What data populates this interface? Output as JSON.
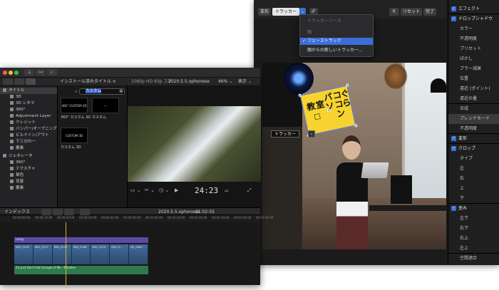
{
  "right_window": {
    "toolbar": {
      "transform_label": "変形",
      "tracker_label": "トラッカー",
      "chevron_glyph": "⌄",
      "link_glyph": "🔗",
      "fit_glyph": "⇱",
      "reset_label": "リセット",
      "done_label": "完了"
    },
    "dropdown": {
      "items": [
        {
          "label": "トラッカーソース"
        },
        {
          "label": "顔"
        },
        {
          "label": "フェーストラック",
          "checked": "✓"
        },
        {
          "label": "顔からの新しいトラッカー..."
        }
      ]
    },
    "video": {
      "sign_text": [
        "コ",
        "ぐ",
        "ら",
        "パ",
        "ソ",
        "コ",
        "ン",
        "教",
        "室",
        "□"
      ],
      "tracker_chip": "トラッカー",
      "tracker_chip_arrow": "⌄"
    },
    "inspector": {
      "items": [
        {
          "label": "エフェクト",
          "checked": true
        },
        {
          "label": "ドロップシャドウ",
          "checked": true
        },
        {
          "label": "カラー"
        },
        {
          "label": "不透明度"
        },
        {
          "label": "プリセット"
        },
        {
          "label": "ぼかし"
        },
        {
          "label": "ブラー減衰"
        },
        {
          "label": "位置"
        },
        {
          "label": "遠近 (ポイント)"
        },
        {
          "label": "遠近の量"
        },
        {
          "label": "合成"
        },
        {
          "label": "ブレンドモード"
        },
        {
          "label": "不透明度"
        },
        {
          "label": "変形",
          "checked": true
        },
        {
          "label": "クロップ",
          "checked": true
        },
        {
          "label": "タイプ"
        },
        {
          "label": "左"
        },
        {
          "label": "右"
        },
        {
          "label": "上"
        },
        {
          "label": "下"
        },
        {
          "label": "歪み",
          "checked": true
        },
        {
          "label": "左下"
        },
        {
          "label": "右下"
        },
        {
          "label": "右上"
        },
        {
          "label": "左上"
        },
        {
          "label": "空間適合"
        }
      ]
    }
  },
  "left_window": {
    "toolbar": {
      "icons": [
        "↓",
        "⊶",
        "✓"
      ]
    },
    "secbar": {
      "library_label": "インストール済みタイトル ≎",
      "format_label": "1080p HD 60p ステ",
      "project_label": "2020.5.5.ophonese",
      "zoom_label": "46% ⌄",
      "display_label": "表示 ⌄"
    },
    "sidebar": {
      "items": [
        {
          "label": "タイトル",
          "selected": true
        },
        {
          "label": "3D"
        },
        {
          "label": "3D シネマ"
        },
        {
          "label": "360°"
        },
        {
          "label": "Adjustment Layer"
        },
        {
          "label": "クレジット"
        },
        {
          "label": "バンパー/オープニング"
        },
        {
          "label": "ビルドイン/アウト"
        },
        {
          "label": "下三分の一"
        },
        {
          "label": "要素"
        },
        {
          "label": "ジェネレータ"
        },
        {
          "label": "360°"
        },
        {
          "label": "テクスチャ"
        },
        {
          "label": "単色"
        },
        {
          "label": "背景"
        },
        {
          "label": "要素"
        }
      ]
    },
    "browser": {
      "search_value": "カスタム",
      "clear_glyph": "⊗",
      "thumbs": [
        {
          "thumb_text": "360° CUSTOM 3D",
          "caption": "360° カスタム 3D"
        },
        {
          "thumb_text": "—",
          "caption": "カスタム"
        },
        {
          "thumb_text": "CUSTOM 3D",
          "caption": "カスタム 3D"
        }
      ]
    },
    "viewer": {
      "timecode": "24:23",
      "controls": [
        "▭ ⌄",
        "✂ ⌄",
        "◷ ⌄",
        "▶",
        "⌓",
        "⤢"
      ]
    },
    "timeline_bar": {
      "index_label": "インデックス",
      "project_label": "2020.5.5.ophonese",
      "duration_label": "01:02:55"
    },
    "ruler": {
      "ticks": [
        "00:00:00:00",
        "00:00:10:00",
        "00:00:20:00",
        "00:00:30:00",
        "00:00:40:00",
        "00:00:50:00",
        "00:01:00:00",
        "00:01:10:00",
        "00:01:20:00",
        "00:01:30:00",
        "00:01:40:00",
        "00:01:50:00"
      ]
    },
    "clips": {
      "title_clip": "Long",
      "video": [
        "IMG_0105",
        "IMG_2127",
        "IMG_0127",
        "IMG_2108",
        "IMG_2115",
        "IMG_0...",
        "DJI_0063"
      ],
      "audio_clip": "03_Just Don't Get Enough of Me - Mikaline"
    }
  }
}
